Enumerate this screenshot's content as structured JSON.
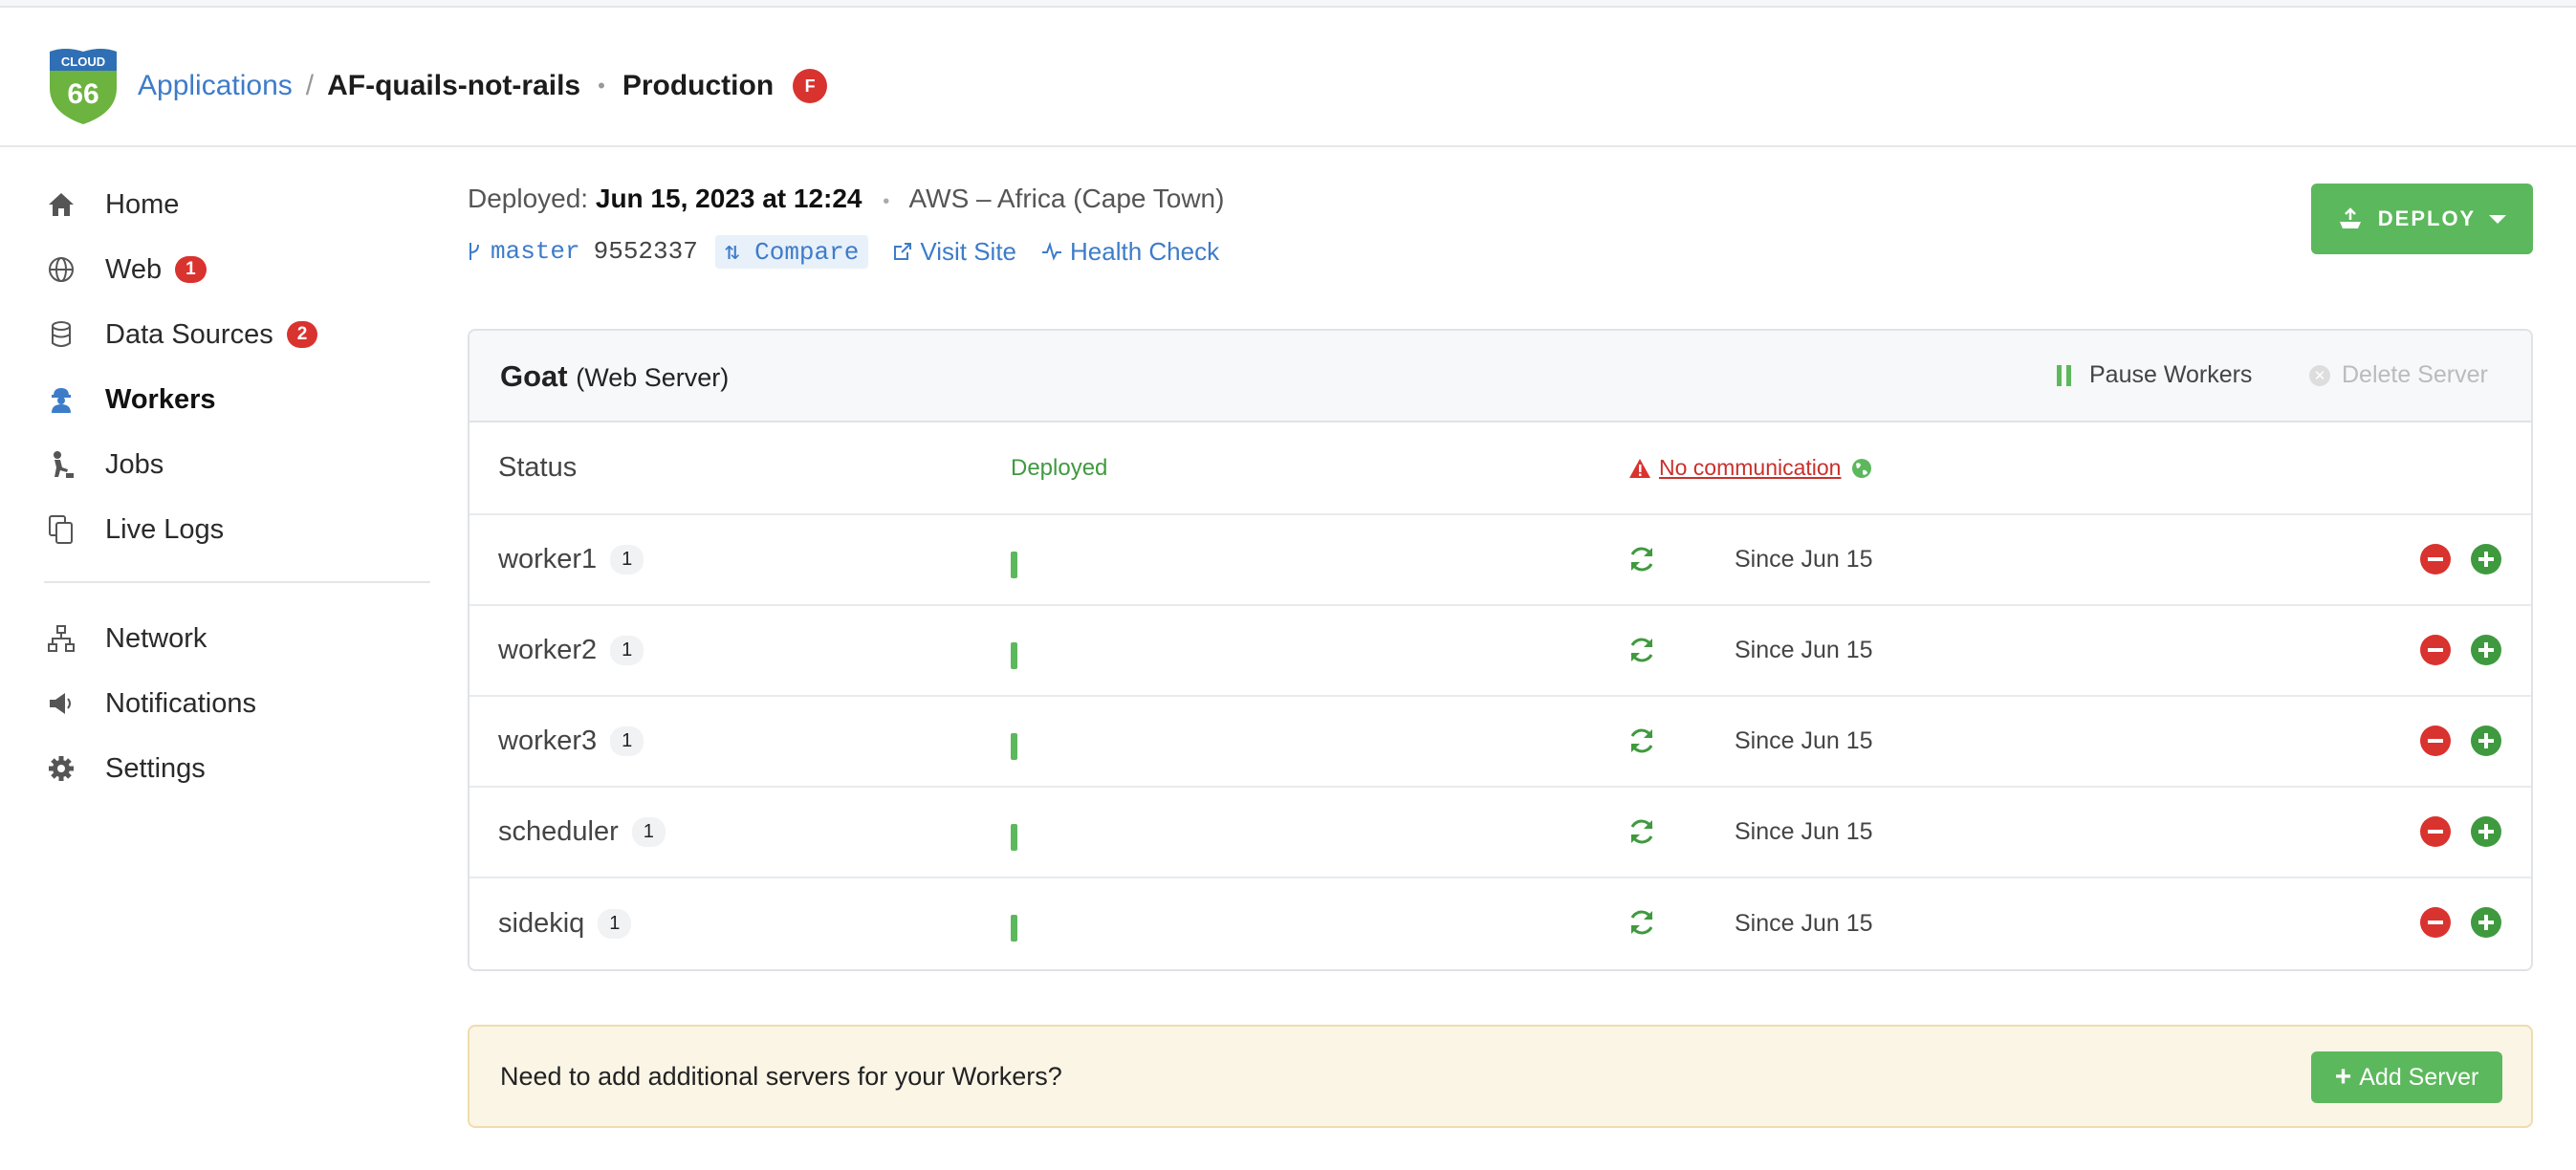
{
  "logo": {
    "top_text": "CLOUD",
    "number": "66"
  },
  "breadcrumb": {
    "applications": "Applications",
    "separator": "/",
    "app_name": "AF-quails-not-rails",
    "dot": "•",
    "environment": "Production",
    "env_badge": "F"
  },
  "sidebar": {
    "items": [
      {
        "label": "Home",
        "icon": "home-icon"
      },
      {
        "label": "Web",
        "icon": "globe-icon",
        "badge": "1"
      },
      {
        "label": "Data Sources",
        "icon": "database-icon",
        "badge": "2"
      },
      {
        "label": "Workers",
        "icon": "worker-icon",
        "active": true
      },
      {
        "label": "Jobs",
        "icon": "jobs-icon"
      },
      {
        "label": "Live Logs",
        "icon": "logs-icon"
      }
    ],
    "secondary": [
      {
        "label": "Network",
        "icon": "network-icon"
      },
      {
        "label": "Notifications",
        "icon": "megaphone-icon"
      },
      {
        "label": "Settings",
        "icon": "gear-icon"
      }
    ]
  },
  "deploy_info": {
    "label": "Deployed:",
    "date": "Jun 15, 2023 at 12:24",
    "dot": "•",
    "cloud": "AWS – Africa (Cape Town)",
    "branch": "master",
    "sha": "9552337",
    "compare": "Compare",
    "visit_site": "Visit Site",
    "health_check": "Health Check"
  },
  "deploy_button": {
    "label": "DEPLOY"
  },
  "panel": {
    "server_name": "Goat",
    "server_type": "(Web Server)",
    "pause_workers": "Pause Workers",
    "delete_server": "Delete Server",
    "status_label": "Status",
    "status_value": "Deployed",
    "communication": "No communication",
    "workers": [
      {
        "name": "worker1",
        "count": "1",
        "since": "Since Jun 15"
      },
      {
        "name": "worker2",
        "count": "1",
        "since": "Since Jun 15"
      },
      {
        "name": "worker3",
        "count": "1",
        "since": "Since Jun 15"
      },
      {
        "name": "scheduler",
        "count": "1",
        "since": "Since Jun 15"
      },
      {
        "name": "sidekiq",
        "count": "1",
        "since": "Since Jun 15"
      }
    ]
  },
  "callout": {
    "text": "Need to add additional servers for your Workers?",
    "button": "Add Server",
    "button_icon": "+"
  },
  "colors": {
    "accent_green": "#5cb85c",
    "link_blue": "#3d7cc9",
    "danger_red": "#d9332f",
    "callout_bg": "#fbf5e6"
  }
}
